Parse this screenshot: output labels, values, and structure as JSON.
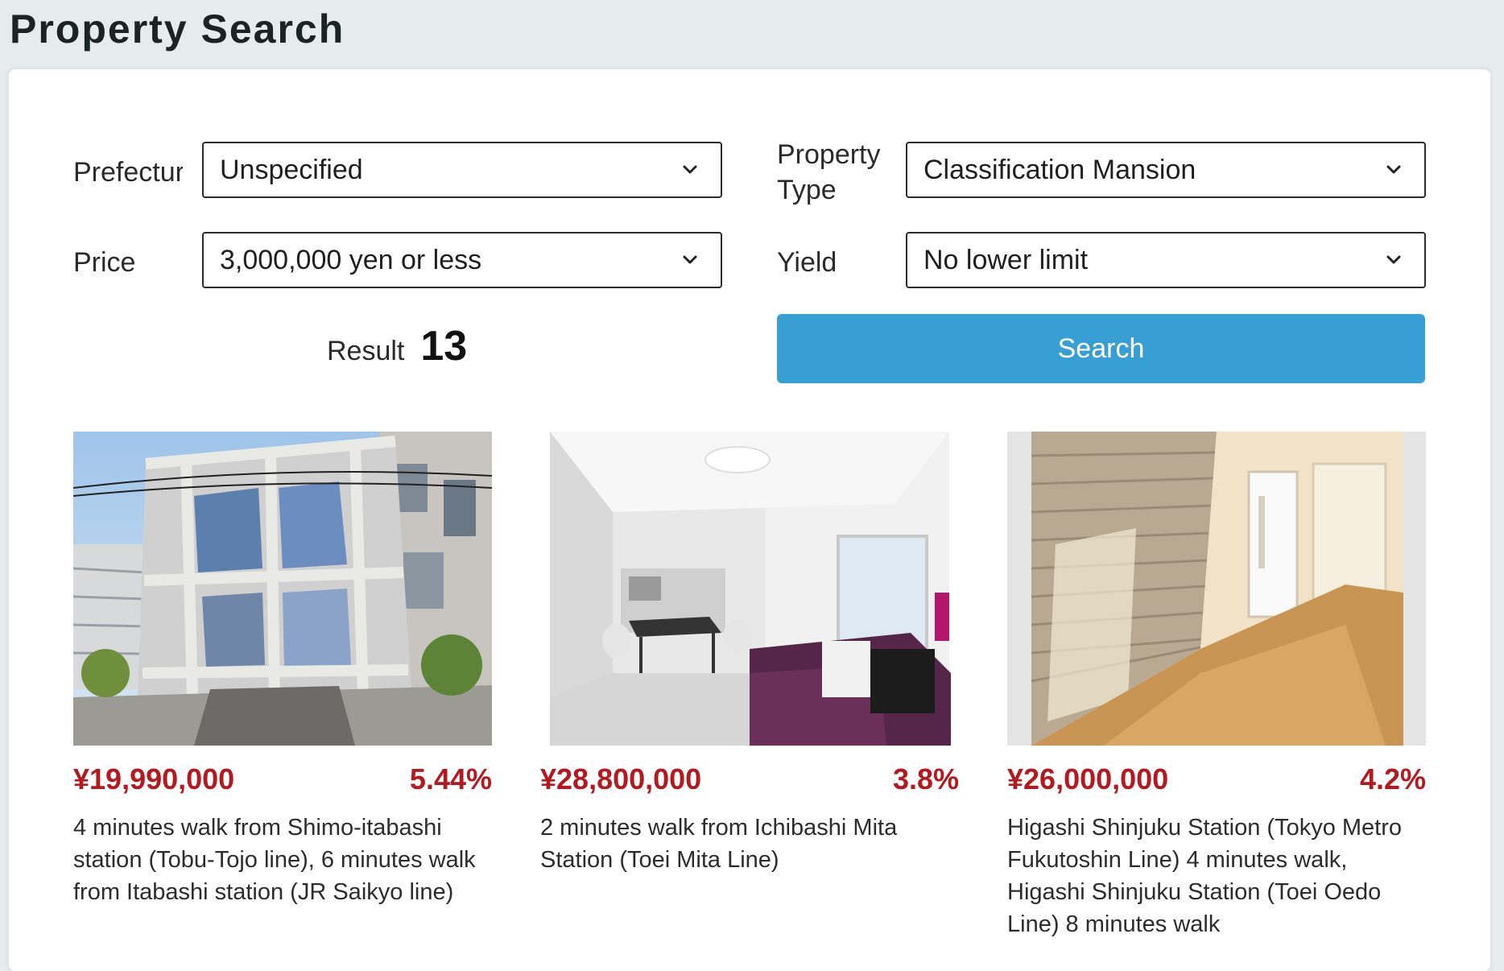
{
  "page": {
    "title": "Property Search"
  },
  "filters": {
    "prefectures": {
      "label": "Prefectures",
      "value": "Unspecified"
    },
    "property_type": {
      "label_line1": "Property",
      "label_line2": "Type",
      "value": "Classification Mansion"
    },
    "price": {
      "label": "Price",
      "value": "3,000,000 yen or less"
    },
    "yield": {
      "label": "Yield",
      "value": "No lower limit"
    }
  },
  "result": {
    "label": "Result",
    "count": "13"
  },
  "search_button": {
    "label": "Search"
  },
  "listings": [
    {
      "price": "¥19,990,000",
      "yield": "5.44%",
      "description": "4 minutes walk from Shimo-itabashi station (Tobu-Tojo line), 6 minutes walk from Itabashi station (JR Saikyo line)"
    },
    {
      "price": "¥28,800,000",
      "yield": "3.8%",
      "description": "2 minutes walk from Ichibashi Mita Station (Toei Mita Line)"
    },
    {
      "price": "¥26,000,000",
      "yield": "4.2%",
      "description": "Higashi Shinjuku Station (Tokyo Metro Fukutoshin Line) 4 minutes walk, Higashi Shinjuku Station (Toei Oedo Line) 8 minutes walk"
    }
  ],
  "colors": {
    "accent": "#379fd3",
    "price": "#b3191f",
    "background": "#e6ecec"
  },
  "icons": {
    "dropdown": "chevron-down-icon"
  }
}
